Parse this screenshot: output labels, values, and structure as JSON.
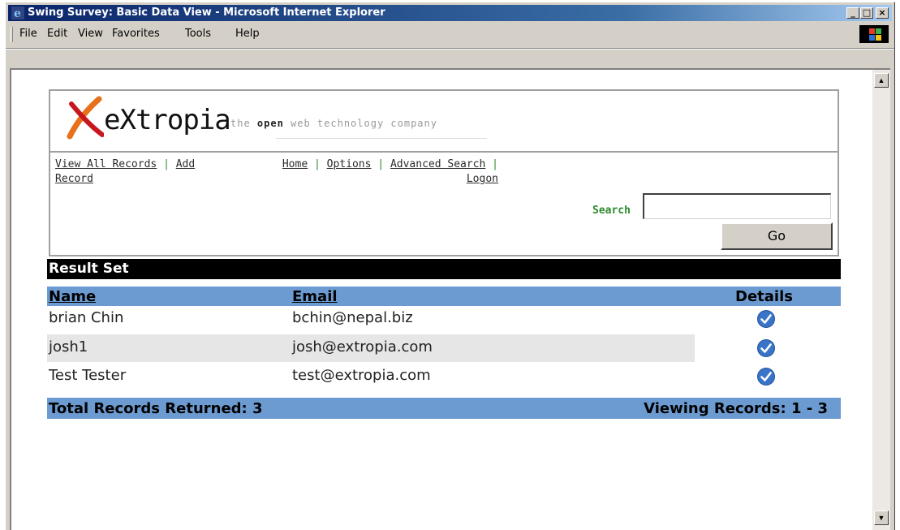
{
  "window": {
    "title": "Swing Survey: Basic Data View - Microsoft Internet Explorer",
    "minimize_glyph": "_",
    "maximize_glyph": "□",
    "close_glyph": "×"
  },
  "menu": {
    "items": [
      "File",
      "Edit",
      "View",
      "Favorites",
      "Tools",
      "Help"
    ]
  },
  "header": {
    "logo_text": "eXtropia",
    "tagline_pre": "the ",
    "tagline_bold": "open",
    "tagline_post": " web technology company"
  },
  "nav": {
    "view_all_records": "View All Records",
    "separator": "|",
    "add": "Add",
    "record": "Record",
    "home": "Home",
    "options": "Options",
    "advanced_search": "Advanced Search",
    "logon": "Logon"
  },
  "search": {
    "label": "Search",
    "value": "",
    "go_label": "Go"
  },
  "results": {
    "title": "Result Set",
    "columns": {
      "name": "Name",
      "email": "Email",
      "details": "Details"
    },
    "rows": [
      {
        "name": "brian Chin",
        "email": "bchin@nepal.biz",
        "details_icon": "check-circle-icon"
      },
      {
        "name": "josh1",
        "email": "josh@extropia.com",
        "details_icon": "check-circle-icon"
      },
      {
        "name": "Test Tester",
        "email": "test@extropia.com",
        "details_icon": "check-circle-icon"
      }
    ],
    "footer_total": "Total Records Returned: 3",
    "footer_viewing": "Viewing Records: 1 - 3"
  },
  "colors": {
    "titlebar": "#0a246a",
    "table_header": "#6b9bd1",
    "separator_green": "#2e8b2e",
    "alt_row": "#e6e6e6",
    "logo_orange": "#e8701a",
    "logo_red": "#c8161e"
  }
}
